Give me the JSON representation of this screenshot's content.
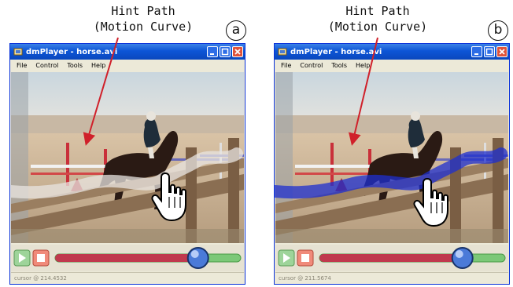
{
  "panels": [
    {
      "id": "a",
      "annotation": {
        "line1": "Hint Path",
        "line2": "(Motion Curve)"
      },
      "label": "a",
      "window": {
        "title": "dmPlayer - horse.avi",
        "menu": [
          "File",
          "Control",
          "Tools",
          "Help"
        ],
        "status": "cursor @ 214.4532",
        "hint_path_color": "#e8e4e0",
        "slider_position": 0.77
      }
    },
    {
      "id": "b",
      "annotation": {
        "line1": "Hint Path",
        "line2": "(Motion Curve)"
      },
      "label": "b",
      "window": {
        "title": "dmPlayer - horse.avi",
        "menu": [
          "File",
          "Control",
          "Tools",
          "Help"
        ],
        "status": "cursor @ 211.5674",
        "hint_path_color": "#1d2fd0",
        "slider_position": 0.77
      }
    }
  ],
  "icons": {
    "play": "play-icon",
    "stop": "stop-icon",
    "hand_cursor": "hand-pointer-icon",
    "annotation_arrow": "arrow-icon"
  },
  "colors": {
    "titlebar": "#0c55d6",
    "progress_played": "#c0394e",
    "progress_remaining": "#6ec36a",
    "annotation_arrow": "#d0202a"
  }
}
